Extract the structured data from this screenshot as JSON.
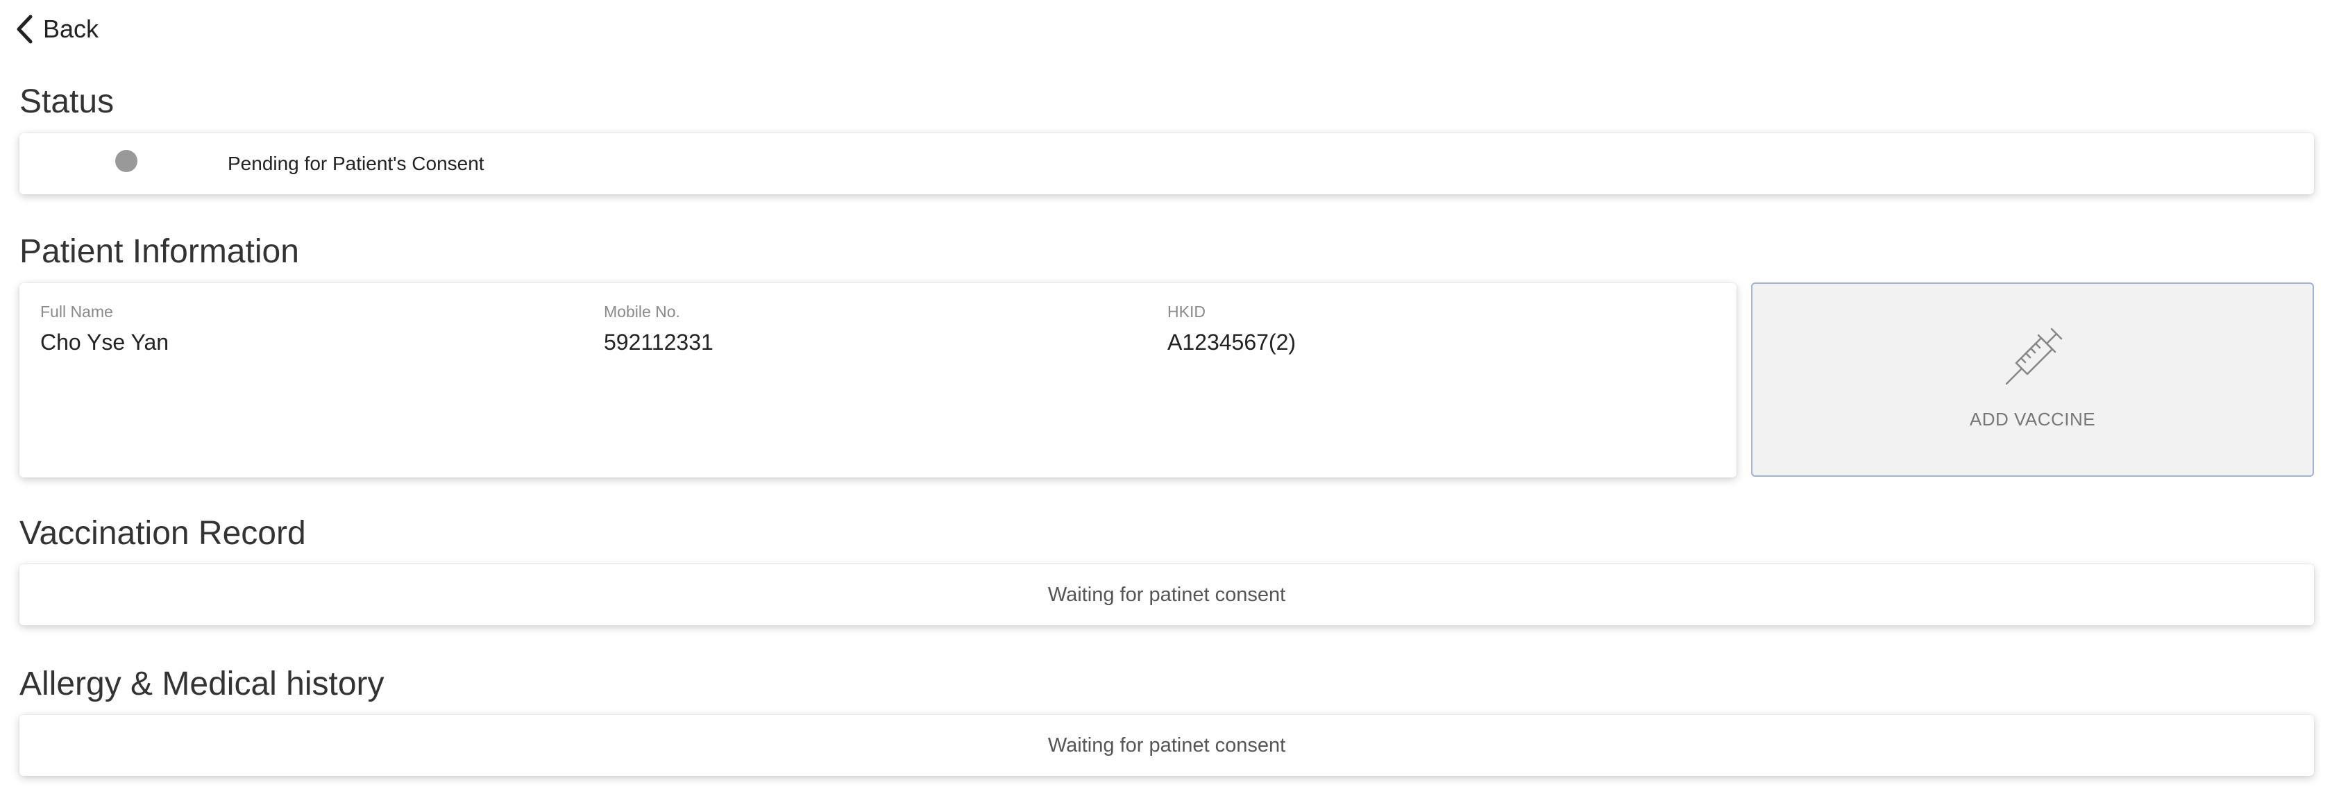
{
  "nav": {
    "back_label": "Back"
  },
  "status": {
    "title": "Status",
    "text": "Pending for Patient's Consent",
    "dot_color": "#999999"
  },
  "patient": {
    "title": "Patient Information",
    "fields": [
      {
        "label": "Full Name",
        "value": "Cho Yse Yan"
      },
      {
        "label": "Mobile No.",
        "value": "592112331"
      },
      {
        "label": "HKID",
        "value": "A1234567(2)"
      }
    ],
    "add_vaccine_label": "ADD VACCINE",
    "add_vaccine_icon": "syringe-icon"
  },
  "vaccination": {
    "title": "Vaccination Record",
    "message": "Waiting for patinet consent"
  },
  "allergy": {
    "title": "Allergy & Medical history",
    "message": "Waiting for patinet consent"
  }
}
